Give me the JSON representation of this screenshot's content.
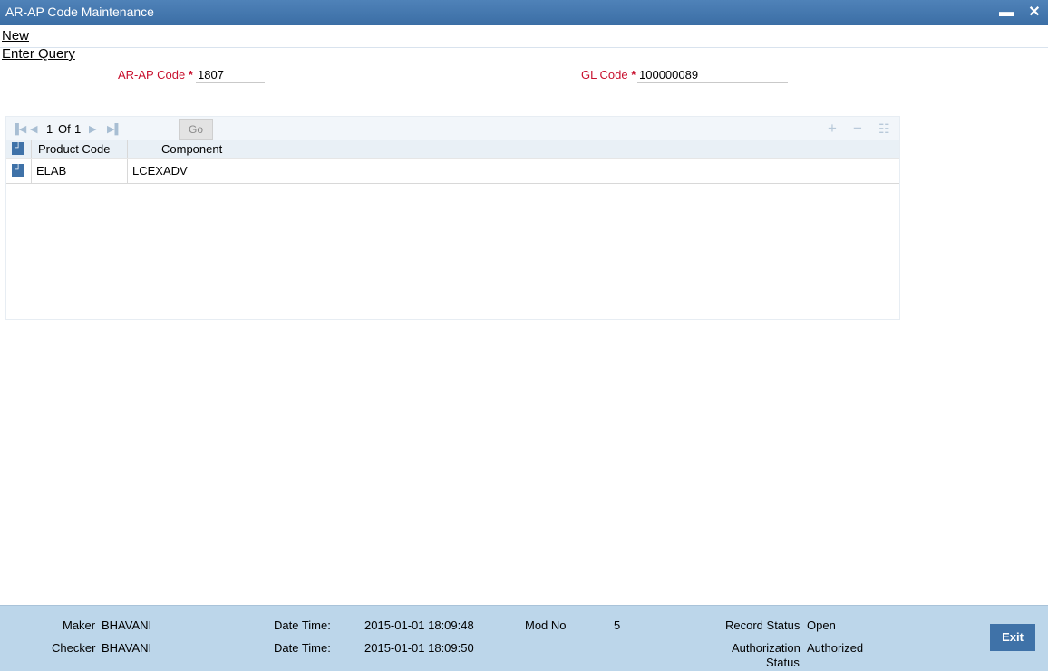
{
  "window": {
    "title": "AR-AP Code Maintenance",
    "minimize_glyph": "▬",
    "close_glyph": "✕"
  },
  "menu": {
    "new_label": "New",
    "enter_query_label": "Enter Query"
  },
  "form": {
    "arap_code_label": "AR-AP Code",
    "arap_code_value": "1807",
    "gl_code_label": "GL Code",
    "gl_code_value": "100000089",
    "required_marker": "*"
  },
  "grid": {
    "pagination": {
      "current": "1",
      "of_label": "Of",
      "total": "1",
      "go_label": "Go"
    },
    "columns": [
      "Product Code",
      "Component"
    ],
    "rows": [
      {
        "product_code": "ELAB",
        "component": "LCEXADV"
      }
    ],
    "icons": {
      "first": "first-page-icon",
      "prev": "prev-page-icon",
      "next": "next-page-icon",
      "last": "last-page-icon",
      "add": "plus-icon",
      "delete": "minus-icon",
      "view": "list-icon"
    }
  },
  "footer": {
    "maker_label": "Maker",
    "maker_value": "BHAVANI",
    "checker_label": "Checker",
    "checker_value": "BHAVANI",
    "maker_datetime_label": "Date Time:",
    "maker_datetime_value": "2015-01-01 18:09:48",
    "checker_datetime_label": "Date Time:",
    "checker_datetime_value": "2015-01-01 18:09:50",
    "mod_no_label": "Mod No",
    "mod_no_value": "5",
    "record_status_label": "Record Status",
    "record_status_value": "Open",
    "auth_status_label_1": "Authorization",
    "auth_status_label_2": "Status",
    "auth_status_value": "Authorized",
    "exit_label": "Exit"
  },
  "colors": {
    "titlebar": "#3b6ea5",
    "required": "#c8102e",
    "footer": "#bcd6ea",
    "button": "#3f72a8"
  }
}
